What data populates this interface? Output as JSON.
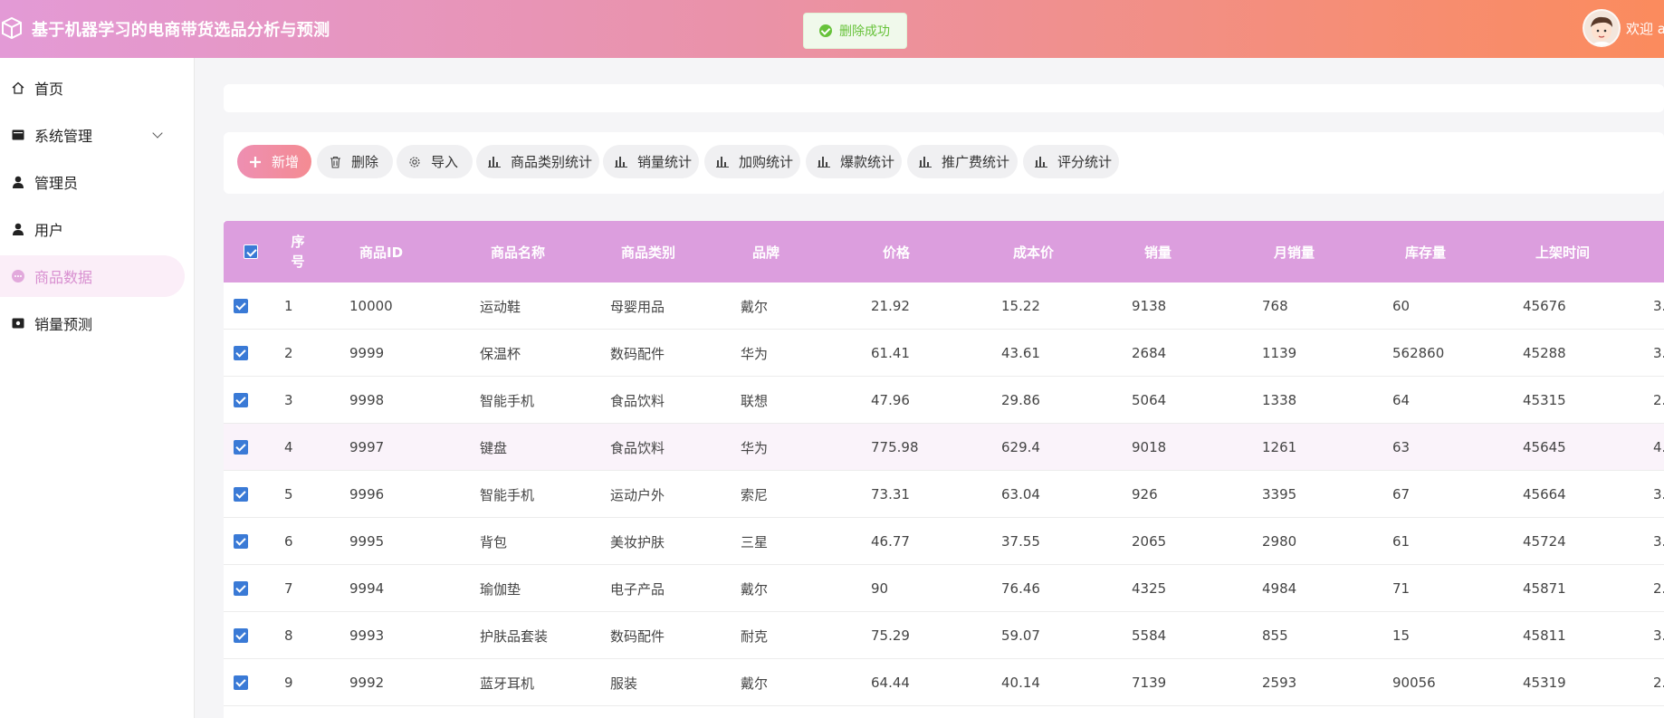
{
  "header": {
    "app_title": "基于机器学习的电商带货选品分析与预测",
    "toast_text": "删除成功",
    "welcome_text": "欢迎 a"
  },
  "sidebar": {
    "items": [
      {
        "label": "首页",
        "icon": "home-icon"
      },
      {
        "label": "系统管理",
        "icon": "system-icon"
      },
      {
        "label": "管理员",
        "icon": "admin-user-icon"
      },
      {
        "label": "用户",
        "icon": "user-icon"
      },
      {
        "label": "商品数据",
        "icon": "dots-icon"
      },
      {
        "label": "销量预测",
        "icon": "forecast-icon"
      }
    ]
  },
  "toolbar": {
    "add": "新增",
    "delete": "删除",
    "import": "导入",
    "category_stats": "商品类别统计",
    "sales_stats": "销量统计",
    "cart_stats": "加购统计",
    "hot_stats": "爆款统计",
    "promo_stats": "推广费统计",
    "rating_stats": "评分统计"
  },
  "table": {
    "columns": [
      "序号",
      "商品ID",
      "商品名称",
      "商品类别",
      "品牌",
      "价格",
      "成本价",
      "销量",
      "月销量",
      "库存量",
      "上架时间"
    ],
    "rows": [
      {
        "idx": "1",
        "id": "10000",
        "name": "运动鞋",
        "category": "母婴用品",
        "brand": "戴尔",
        "price": "21.92",
        "cost": "15.22",
        "sales": "9138",
        "monthly": "768",
        "stock": "60",
        "listed": "45676",
        "extra": "3."
      },
      {
        "idx": "2",
        "id": "9999",
        "name": "保温杯",
        "category": "数码配件",
        "brand": "华为",
        "price": "61.41",
        "cost": "43.61",
        "sales": "2684",
        "monthly": "1139",
        "stock": "562860",
        "listed": "45288",
        "extra": "3."
      },
      {
        "idx": "3",
        "id": "9998",
        "name": "智能手机",
        "category": "食品饮料",
        "brand": "联想",
        "price": "47.96",
        "cost": "29.86",
        "sales": "5064",
        "monthly": "1338",
        "stock": "64",
        "listed": "45315",
        "extra": "2."
      },
      {
        "idx": "4",
        "id": "9997",
        "name": "键盘",
        "category": "食品饮料",
        "brand": "华为",
        "price": "775.98",
        "cost": "629.4",
        "sales": "9018",
        "monthly": "1261",
        "stock": "63",
        "listed": "45645",
        "extra": "4."
      },
      {
        "idx": "5",
        "id": "9996",
        "name": "智能手机",
        "category": "运动户外",
        "brand": "索尼",
        "price": "73.31",
        "cost": "63.04",
        "sales": "926",
        "monthly": "3395",
        "stock": "67",
        "listed": "45664",
        "extra": "3."
      },
      {
        "idx": "6",
        "id": "9995",
        "name": "背包",
        "category": "美妆护肤",
        "brand": "三星",
        "price": "46.77",
        "cost": "37.55",
        "sales": "2065",
        "monthly": "2980",
        "stock": "61",
        "listed": "45724",
        "extra": "3."
      },
      {
        "idx": "7",
        "id": "9994",
        "name": "瑜伽垫",
        "category": "电子产品",
        "brand": "戴尔",
        "price": "90",
        "cost": "76.46",
        "sales": "4325",
        "monthly": "4984",
        "stock": "71",
        "listed": "45871",
        "extra": "2."
      },
      {
        "idx": "8",
        "id": "9993",
        "name": "护肤品套装",
        "category": "数码配件",
        "brand": "耐克",
        "price": "75.29",
        "cost": "59.07",
        "sales": "5584",
        "monthly": "855",
        "stock": "15",
        "listed": "45811",
        "extra": "3."
      },
      {
        "idx": "9",
        "id": "9992",
        "name": "蓝牙耳机",
        "category": "服装",
        "brand": "戴尔",
        "price": "64.44",
        "cost": "40.14",
        "sales": "7139",
        "monthly": "2593",
        "stock": "90056",
        "listed": "45319",
        "extra": "2."
      }
    ]
  },
  "colors": {
    "header_gradient_start": "#e39ad6",
    "header_gradient_end": "#fb8b5d",
    "table_header": "#dc9ede",
    "checkbox": "#3a7ad6",
    "active_nav_text": "#d88fd0",
    "toast_success": "#67c23a"
  }
}
